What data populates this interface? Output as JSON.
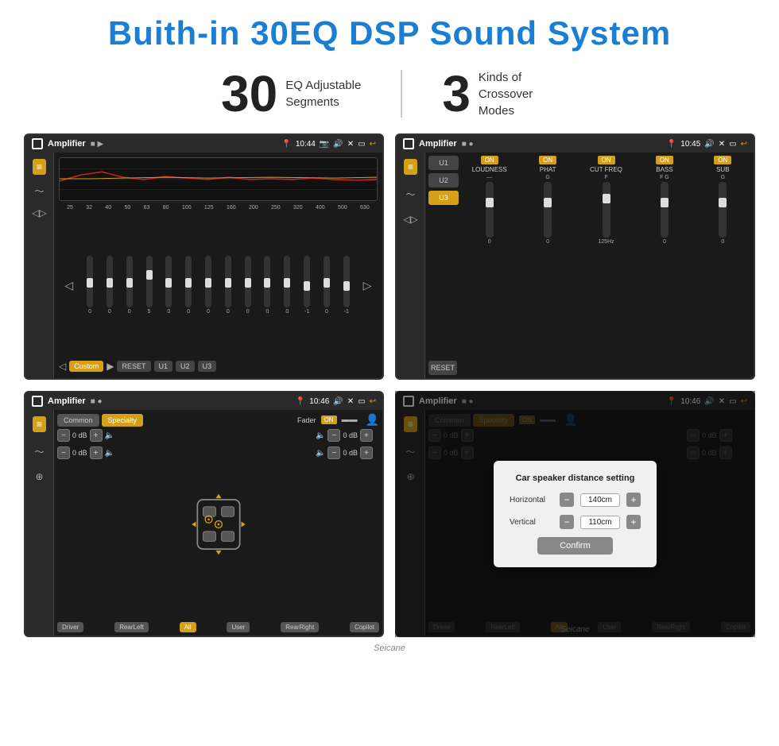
{
  "header": {
    "title": "Buith-in 30EQ DSP Sound System",
    "title_color": "#1a7fd4"
  },
  "stats": [
    {
      "number": "30",
      "desc_line1": "EQ Adjustable",
      "desc_line2": "Segments"
    },
    {
      "number": "3",
      "desc_line1": "Kinds of",
      "desc_line2": "Crossover Modes"
    }
  ],
  "screens": [
    {
      "id": "screen-eq1",
      "status": {
        "label": "Amplifier",
        "time": "10:44"
      },
      "type": "eq",
      "frequencies": [
        "25",
        "32",
        "40",
        "50",
        "63",
        "80",
        "100",
        "125",
        "160",
        "200",
        "250",
        "320",
        "400",
        "500",
        "630"
      ],
      "values": [
        "0",
        "0",
        "0",
        "5",
        "0",
        "0",
        "0",
        "0",
        "0",
        "0",
        "0",
        "-1",
        "0",
        "-1"
      ],
      "presets": [
        "Custom",
        "RESET",
        "U1",
        "U2",
        "U3"
      ]
    },
    {
      "id": "screen-crossover",
      "status": {
        "label": "Amplifier",
        "time": "10:45"
      },
      "type": "crossover",
      "presets": [
        "U1",
        "U2",
        "U3"
      ],
      "active_preset": "U3",
      "channels": [
        {
          "name": "LOUDNESS",
          "on": true
        },
        {
          "name": "PHAT",
          "on": true
        },
        {
          "name": "CUT FREQ",
          "on": true
        },
        {
          "name": "BASS",
          "on": true
        },
        {
          "name": "SUB",
          "on": true
        }
      ],
      "reset_label": "RESET"
    },
    {
      "id": "screen-speaker",
      "status": {
        "label": "Amplifier",
        "time": "10:46"
      },
      "type": "speaker",
      "tabs": [
        "Common",
        "Specialty"
      ],
      "active_tab": "Specialty",
      "fader_label": "Fader",
      "fader_on": "ON",
      "channels": [
        {
          "side": "left",
          "db": "0 dB"
        },
        {
          "side": "left",
          "db": "0 dB"
        },
        {
          "side": "right",
          "db": "0 dB"
        },
        {
          "side": "right",
          "db": "0 dB"
        }
      ],
      "zones": [
        "Driver",
        "RearLeft",
        "All",
        "User",
        "RearRight",
        "Copilot"
      ]
    },
    {
      "id": "screen-distance",
      "status": {
        "label": "Amplifier",
        "time": "10:46"
      },
      "type": "speaker-dialog",
      "tabs": [
        "Common",
        "Specialty"
      ],
      "active_tab": "Specialty",
      "fader_on": "ON",
      "dialog": {
        "title": "Car speaker distance setting",
        "horizontal_label": "Horizontal",
        "horizontal_value": "140cm",
        "vertical_label": "Vertical",
        "vertical_value": "110cm",
        "confirm_label": "Confirm"
      },
      "zones": [
        "Driver",
        "RearLeft",
        "All",
        "User",
        "RearRight",
        "Copilot"
      ]
    }
  ],
  "watermark": "Seicane"
}
